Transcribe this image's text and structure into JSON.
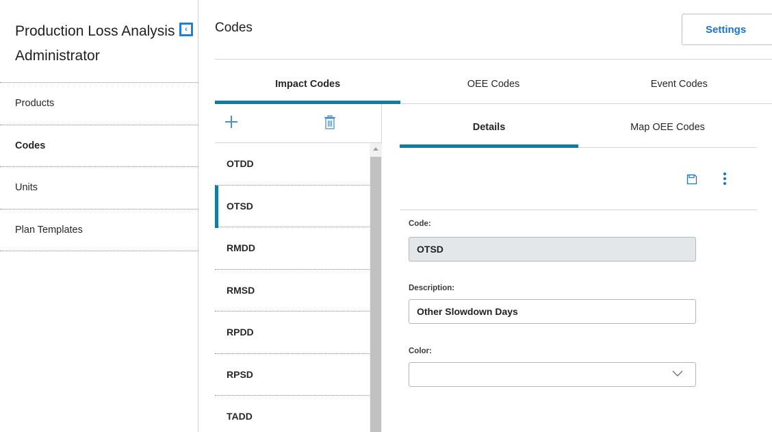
{
  "nav": {
    "title": "Production Loss Analysis Administrator",
    "items": [
      {
        "label": "Products"
      },
      {
        "label": "Codes"
      },
      {
        "label": "Units"
      },
      {
        "label": "Plan Templates"
      }
    ],
    "active_index": 1
  },
  "header": {
    "title": "Codes",
    "settings_label": "Settings"
  },
  "tabs": [
    {
      "label": "Impact Codes",
      "active": true
    },
    {
      "label": "OEE Codes",
      "active": false
    },
    {
      "label": "Event Codes",
      "active": false
    }
  ],
  "code_list": {
    "items": [
      "OTDD",
      "OTSD",
      "RMDD",
      "RMSD",
      "RPDD",
      "RPSD",
      "TADD"
    ],
    "selected": "OTSD"
  },
  "detail_tabs": [
    {
      "label": "Details",
      "active": true
    },
    {
      "label": "Map OEE Codes",
      "active": false
    }
  ],
  "form": {
    "code_label": "Code:",
    "code_value": "OTSD",
    "description_label": "Description:",
    "description_value": "Other Slowdown Days",
    "color_label": "Color:",
    "color_value": ""
  },
  "icons": {
    "collapse": "chevron-left-icon",
    "add": "plus-icon",
    "delete": "trash-icon",
    "save": "save-icon",
    "more": "more-vertical-icon",
    "dropdown": "chevron-down-icon"
  },
  "colors": {
    "accent": "#137c9e",
    "link": "#1a73c7"
  }
}
